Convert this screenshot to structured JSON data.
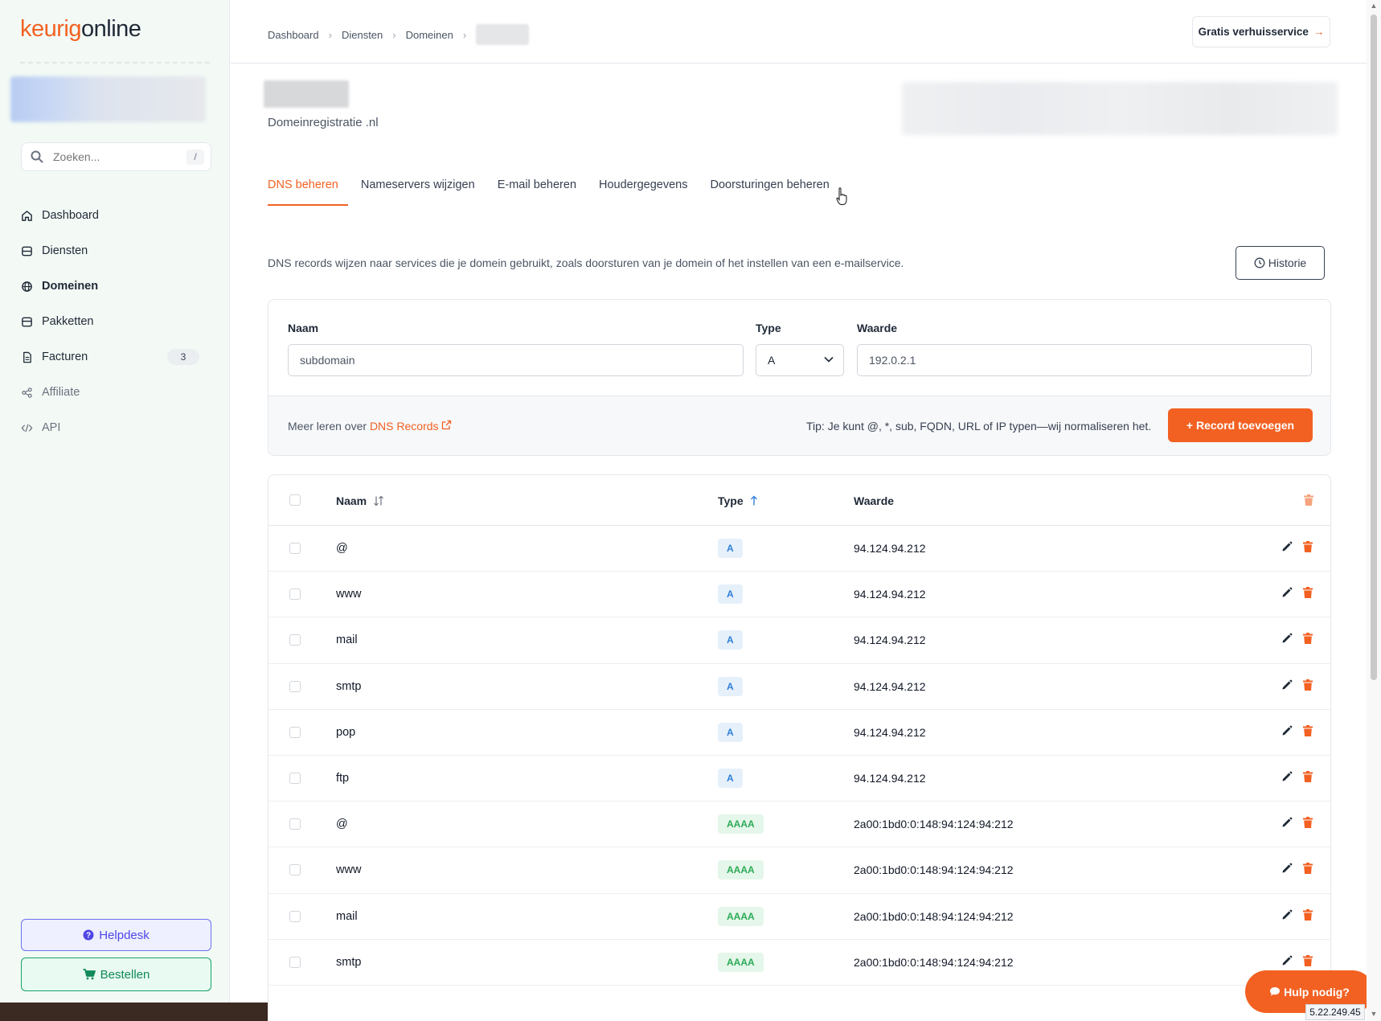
{
  "brand": {
    "part1": "keurig",
    "part2": "online"
  },
  "search": {
    "placeholder": "Zoeken...",
    "shortcut": "/"
  },
  "nav": [
    {
      "label": "Dashboard",
      "icon": "home-icon"
    },
    {
      "label": "Diensten",
      "icon": "server-icon"
    },
    {
      "label": "Domeinen",
      "icon": "globe-icon",
      "active": true
    },
    {
      "label": "Pakketten",
      "icon": "package-icon"
    },
    {
      "label": "Facturen",
      "icon": "document-icon",
      "badge": "3"
    },
    {
      "label": "Affiliate",
      "icon": "share-icon"
    },
    {
      "label": "API",
      "icon": "code-icon"
    }
  ],
  "sidebar_buttons": {
    "helpdesk": "Helpdesk",
    "order": "Bestellen"
  },
  "breadcrumb": [
    "Dashboard",
    "Diensten",
    "Domeinen"
  ],
  "header": {
    "move_service": "Gratis verhuisservice",
    "move_arrow": "→"
  },
  "domain": {
    "subtitle": "Domeinregistratie .nl"
  },
  "tabs": [
    "DNS beheren",
    "Nameservers wijzigen",
    "E-mail beheren",
    "Houdergegevens",
    "Doorsturingen beheren"
  ],
  "info_text": "DNS records wijzen naar services die je domein gebruikt, zoals doorsturen van je domein of het instellen van een e-mailservice.",
  "history_button": "Historie",
  "form": {
    "name_label": "Naam",
    "type_label": "Type",
    "value_label": "Waarde",
    "name_placeholder": "subdomain",
    "type_value": "A",
    "value_placeholder": "192.0.2.1",
    "learn_prefix": "Meer leren over",
    "learn_link": "DNS Records",
    "tip": "Tip: Je kunt @, *, sub, FQDN, URL of IP typen—wij normaliseren het.",
    "add_button": "+ Record toevoegen"
  },
  "table": {
    "headers": {
      "name": "Naam",
      "type": "Type",
      "value": "Waarde"
    },
    "rows": [
      {
        "name": "@",
        "type": "A",
        "value": "94.124.94.212"
      },
      {
        "name": "www",
        "type": "A",
        "value": "94.124.94.212"
      },
      {
        "name": "mail",
        "type": "A",
        "value": "94.124.94.212"
      },
      {
        "name": "smtp",
        "type": "A",
        "value": "94.124.94.212"
      },
      {
        "name": "pop",
        "type": "A",
        "value": "94.124.94.212"
      },
      {
        "name": "ftp",
        "type": "A",
        "value": "94.124.94.212"
      },
      {
        "name": "@",
        "type": "AAAA",
        "value": "2a00:1bd0:0:148:94:124:94:212"
      },
      {
        "name": "www",
        "type": "AAAA",
        "value": "2a00:1bd0:0:148:94:124:94:212"
      },
      {
        "name": "mail",
        "type": "AAAA",
        "value": "2a00:1bd0:0:148:94:124:94:212"
      },
      {
        "name": "smtp",
        "type": "AAAA",
        "value": "2a00:1bd0:0:148:94:124:94:212"
      }
    ]
  },
  "chat_button": "Hulp nodig?",
  "ip_address": "5.22.249.45",
  "colors": {
    "accent": "#f26122",
    "a_badge": "#2f7fd8",
    "aaaa_badge": "#2bab56"
  }
}
